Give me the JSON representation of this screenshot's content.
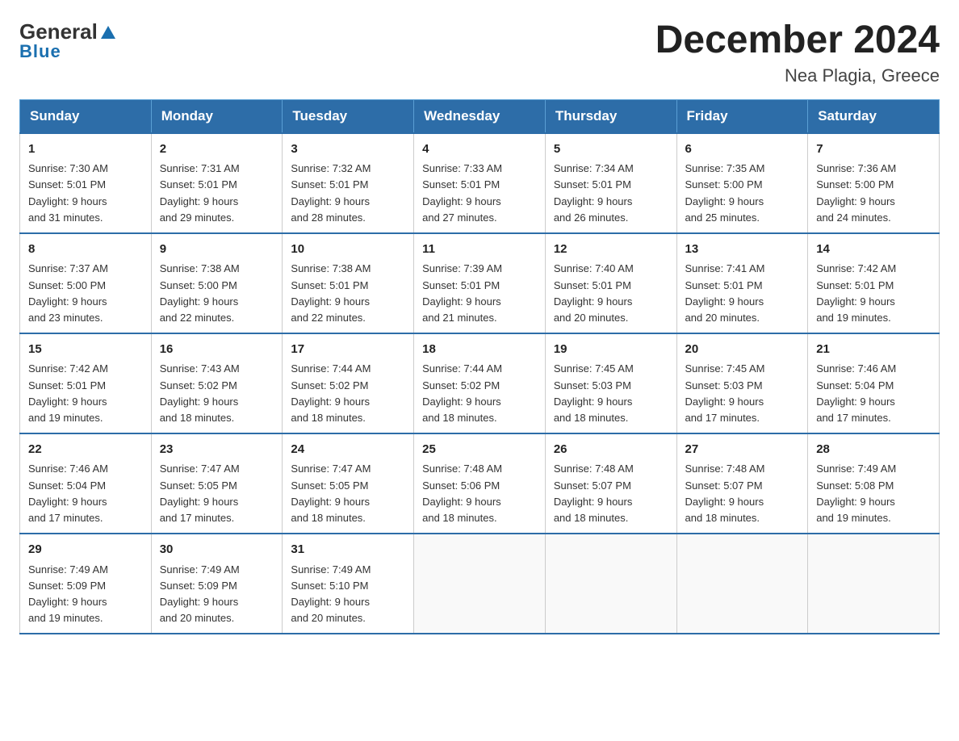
{
  "logo": {
    "line1": "General",
    "arrow": "▲",
    "line2": "Blue"
  },
  "title": "December 2024",
  "location": "Nea Plagia, Greece",
  "days_of_week": [
    "Sunday",
    "Monday",
    "Tuesday",
    "Wednesday",
    "Thursday",
    "Friday",
    "Saturday"
  ],
  "weeks": [
    [
      {
        "day": "1",
        "sunrise": "7:30 AM",
        "sunset": "5:01 PM",
        "daylight": "9 hours and 31 minutes."
      },
      {
        "day": "2",
        "sunrise": "7:31 AM",
        "sunset": "5:01 PM",
        "daylight": "9 hours and 29 minutes."
      },
      {
        "day": "3",
        "sunrise": "7:32 AM",
        "sunset": "5:01 PM",
        "daylight": "9 hours and 28 minutes."
      },
      {
        "day": "4",
        "sunrise": "7:33 AM",
        "sunset": "5:01 PM",
        "daylight": "9 hours and 27 minutes."
      },
      {
        "day": "5",
        "sunrise": "7:34 AM",
        "sunset": "5:01 PM",
        "daylight": "9 hours and 26 minutes."
      },
      {
        "day": "6",
        "sunrise": "7:35 AM",
        "sunset": "5:00 PM",
        "daylight": "9 hours and 25 minutes."
      },
      {
        "day": "7",
        "sunrise": "7:36 AM",
        "sunset": "5:00 PM",
        "daylight": "9 hours and 24 minutes."
      }
    ],
    [
      {
        "day": "8",
        "sunrise": "7:37 AM",
        "sunset": "5:00 PM",
        "daylight": "9 hours and 23 minutes."
      },
      {
        "day": "9",
        "sunrise": "7:38 AM",
        "sunset": "5:00 PM",
        "daylight": "9 hours and 22 minutes."
      },
      {
        "day": "10",
        "sunrise": "7:38 AM",
        "sunset": "5:01 PM",
        "daylight": "9 hours and 22 minutes."
      },
      {
        "day": "11",
        "sunrise": "7:39 AM",
        "sunset": "5:01 PM",
        "daylight": "9 hours and 21 minutes."
      },
      {
        "day": "12",
        "sunrise": "7:40 AM",
        "sunset": "5:01 PM",
        "daylight": "9 hours and 20 minutes."
      },
      {
        "day": "13",
        "sunrise": "7:41 AM",
        "sunset": "5:01 PM",
        "daylight": "9 hours and 20 minutes."
      },
      {
        "day": "14",
        "sunrise": "7:42 AM",
        "sunset": "5:01 PM",
        "daylight": "9 hours and 19 minutes."
      }
    ],
    [
      {
        "day": "15",
        "sunrise": "7:42 AM",
        "sunset": "5:01 PM",
        "daylight": "9 hours and 19 minutes."
      },
      {
        "day": "16",
        "sunrise": "7:43 AM",
        "sunset": "5:02 PM",
        "daylight": "9 hours and 18 minutes."
      },
      {
        "day": "17",
        "sunrise": "7:44 AM",
        "sunset": "5:02 PM",
        "daylight": "9 hours and 18 minutes."
      },
      {
        "day": "18",
        "sunrise": "7:44 AM",
        "sunset": "5:02 PM",
        "daylight": "9 hours and 18 minutes."
      },
      {
        "day": "19",
        "sunrise": "7:45 AM",
        "sunset": "5:03 PM",
        "daylight": "9 hours and 18 minutes."
      },
      {
        "day": "20",
        "sunrise": "7:45 AM",
        "sunset": "5:03 PM",
        "daylight": "9 hours and 17 minutes."
      },
      {
        "day": "21",
        "sunrise": "7:46 AM",
        "sunset": "5:04 PM",
        "daylight": "9 hours and 17 minutes."
      }
    ],
    [
      {
        "day": "22",
        "sunrise": "7:46 AM",
        "sunset": "5:04 PM",
        "daylight": "9 hours and 17 minutes."
      },
      {
        "day": "23",
        "sunrise": "7:47 AM",
        "sunset": "5:05 PM",
        "daylight": "9 hours and 17 minutes."
      },
      {
        "day": "24",
        "sunrise": "7:47 AM",
        "sunset": "5:05 PM",
        "daylight": "9 hours and 18 minutes."
      },
      {
        "day": "25",
        "sunrise": "7:48 AM",
        "sunset": "5:06 PM",
        "daylight": "9 hours and 18 minutes."
      },
      {
        "day": "26",
        "sunrise": "7:48 AM",
        "sunset": "5:07 PM",
        "daylight": "9 hours and 18 minutes."
      },
      {
        "day": "27",
        "sunrise": "7:48 AM",
        "sunset": "5:07 PM",
        "daylight": "9 hours and 18 minutes."
      },
      {
        "day": "28",
        "sunrise": "7:49 AM",
        "sunset": "5:08 PM",
        "daylight": "9 hours and 19 minutes."
      }
    ],
    [
      {
        "day": "29",
        "sunrise": "7:49 AM",
        "sunset": "5:09 PM",
        "daylight": "9 hours and 19 minutes."
      },
      {
        "day": "30",
        "sunrise": "7:49 AM",
        "sunset": "5:09 PM",
        "daylight": "9 hours and 20 minutes."
      },
      {
        "day": "31",
        "sunrise": "7:49 AM",
        "sunset": "5:10 PM",
        "daylight": "9 hours and 20 minutes."
      },
      null,
      null,
      null,
      null
    ]
  ],
  "labels": {
    "sunrise": "Sunrise:",
    "sunset": "Sunset:",
    "daylight": "Daylight:"
  }
}
